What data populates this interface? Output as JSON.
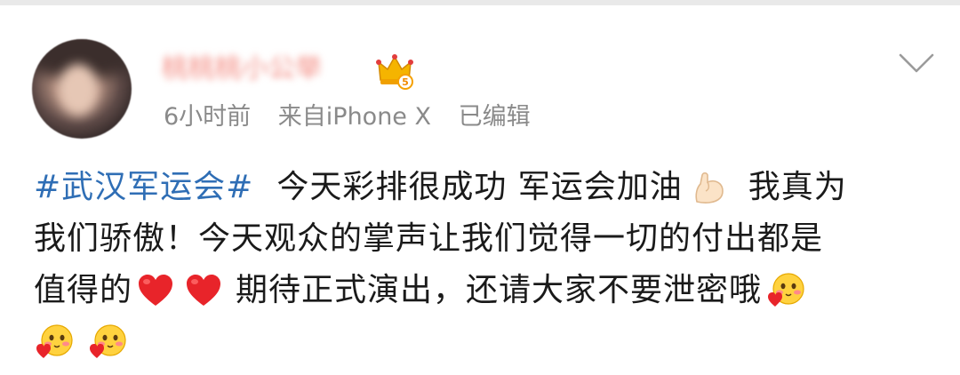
{
  "post": {
    "username": "桃桃桃小公举",
    "time": "6小时前",
    "source": "来自iPhone X",
    "edited": "已编辑",
    "hashtag": "#武汉军运会#",
    "line1_text": "今天彩排很成功 军运会加油",
    "line1_text2": "我真为",
    "line2_text": "我们骄傲！今天观众的掌声让我们觉得一切的付出都是",
    "line3_text1": "值得的",
    "line3_text2": "期待正式演出，还请大家不要泄密哦"
  },
  "icons": {
    "vip": "crown-vip-icon",
    "more": "chevron-down-icon",
    "strong": "flexed-biceps-emoji",
    "heart": "red-heart-emoji",
    "blush": "blushing-heart-face-emoji"
  },
  "colors": {
    "hashtag": "#2f6eb5",
    "meta": "#8a8a8a",
    "username": "#f38a80",
    "text": "#1a1a1a"
  }
}
